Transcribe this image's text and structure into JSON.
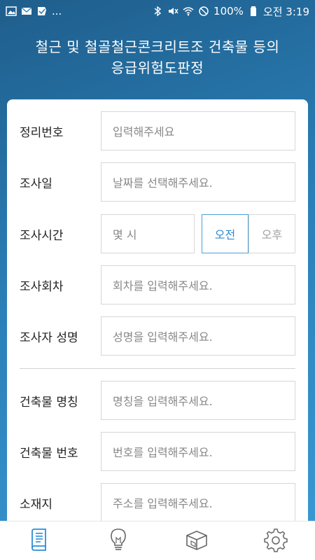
{
  "status_bar": {
    "ellipsis": "...",
    "battery_percent": "100%",
    "time": "오전 3:19",
    "icons_left": [
      "image-icon",
      "mail-icon",
      "check-icon"
    ],
    "icons_right": [
      "bluetooth-icon",
      "mute-icon",
      "wifi-icon",
      "no-sign-icon",
      "battery-icon"
    ]
  },
  "title": {
    "line1": "철근 및 철골철근콘크리트조 건축물 등의",
    "line2": "응급위험도판정"
  },
  "form": {
    "fields": [
      {
        "label": "정리번호",
        "placeholder": "입력해주세요"
      },
      {
        "label": "조사일",
        "placeholder": "날짜를 선택해주세요."
      },
      {
        "label": "조사시간",
        "placeholder": "몇 시"
      },
      {
        "label": "조사회차",
        "placeholder": "회차를 입력해주세요."
      },
      {
        "label": "조사자 성명",
        "placeholder": "성명을 입력해주세요."
      },
      {
        "label": "건축물 명칭",
        "placeholder": "명칭을 입력해주세요."
      },
      {
        "label": "건축물 번호",
        "placeholder": "번호를 입력해주세요."
      },
      {
        "label": "소재지",
        "placeholder": "주소를 입력해주세요."
      }
    ],
    "ampm": {
      "am": "오전",
      "pm": "오후",
      "selected": "am"
    }
  },
  "bottom_nav": {
    "items": [
      "document-icon",
      "lightbulb-icon",
      "box-icon",
      "gear-icon"
    ],
    "active": "document-icon",
    "colors": {
      "active": "#2a8fd6",
      "inactive": "#666666"
    }
  }
}
